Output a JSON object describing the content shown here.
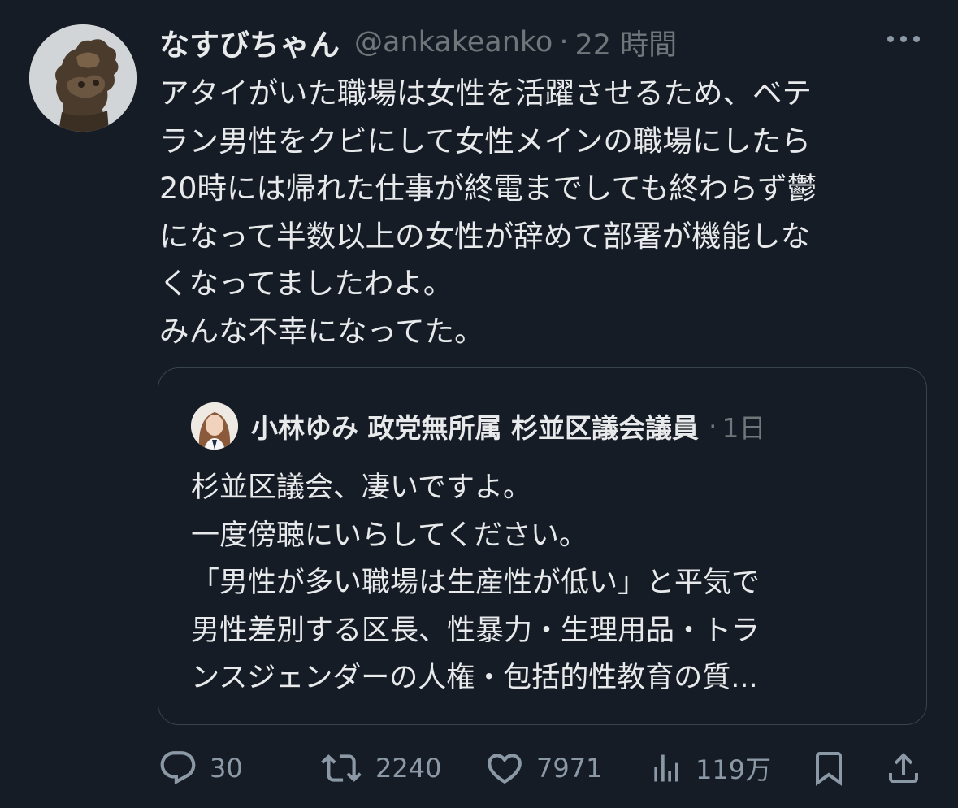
{
  "tweet": {
    "display_name": "なすびちゃん",
    "handle": "@ankakeanko",
    "separator": "·",
    "time": "22 時間",
    "more_label": "•••",
    "text": "アタイがいた職場は女性を活躍させるため、ベテ\nラン男性をクビにして女性メインの職場にしたら\n20時には帰れた仕事が終電までしても終わらず鬱\nになって半数以上の女性が辞めて部署が機能しな\nくなってましたわよ。\nみんな不幸になってた。"
  },
  "quote": {
    "display_name": "小林ゆみ 政党無所属 杉並区議会議員",
    "separator": "·",
    "time": "1日",
    "text": "杉並区議会、凄いですよ。\n一度傍聴にいらしてください。\n「男性が多い職場は生産性が低い」と平気で\n男性差別する区長、性暴力・生理用品・トラ\nンスジェンダーの人権・包括的性教育の質..."
  },
  "actions": {
    "replies": "30",
    "reposts": "2240",
    "likes": "7971",
    "views": "119万"
  },
  "colors": {
    "background": "#161c26",
    "text": "#e7e9ea",
    "muted": "#71767b",
    "icon": "#8b98a5",
    "border": "#38444d"
  },
  "icons": [
    "more-icon",
    "reply-icon",
    "repost-icon",
    "like-icon",
    "views-icon",
    "bookmark-icon",
    "share-icon"
  ]
}
